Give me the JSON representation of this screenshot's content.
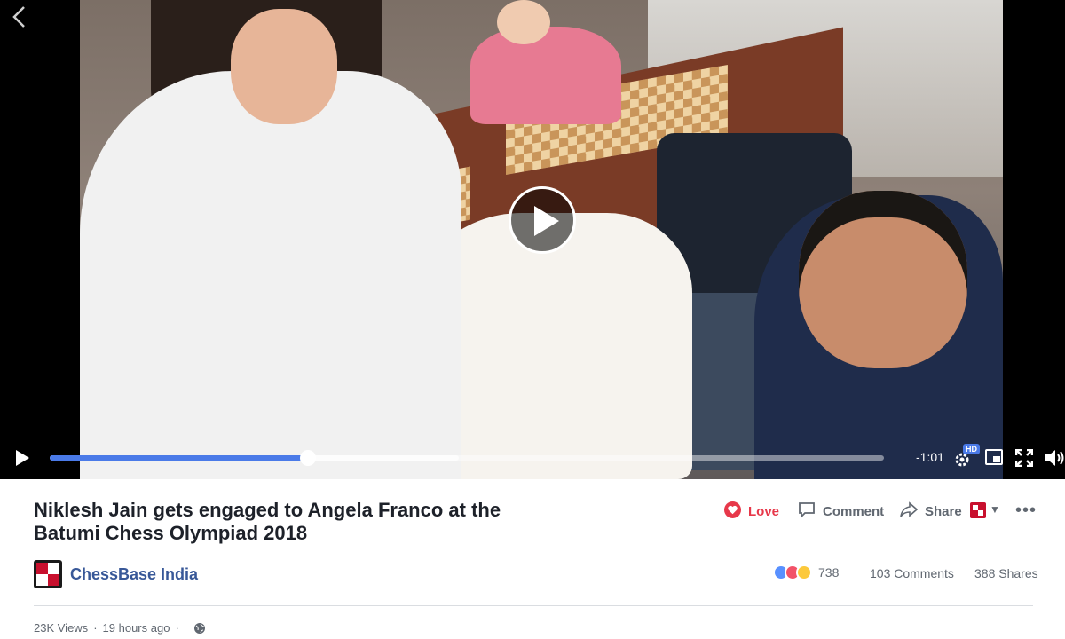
{
  "video": {
    "time_remaining": "-1:01",
    "progress_fraction": 0.31,
    "buffer_fraction": 0.49,
    "quality_badge": "HD"
  },
  "post": {
    "title": "Niklesh Jain gets engaged to Angela Franco at the Batumi Chess Olympiad 2018",
    "page_name": "ChessBase India",
    "actions": {
      "love": "Love",
      "comment": "Comment",
      "share": "Share"
    },
    "reaction_count": "738",
    "comments": "103 Comments",
    "shares": "388 Shares",
    "views": "23K Views",
    "time_ago": "19 hours ago"
  },
  "colors": {
    "love_red": "#e7384a",
    "progress_blue": "#4a7ae8",
    "page_name_blue": "#385898"
  }
}
